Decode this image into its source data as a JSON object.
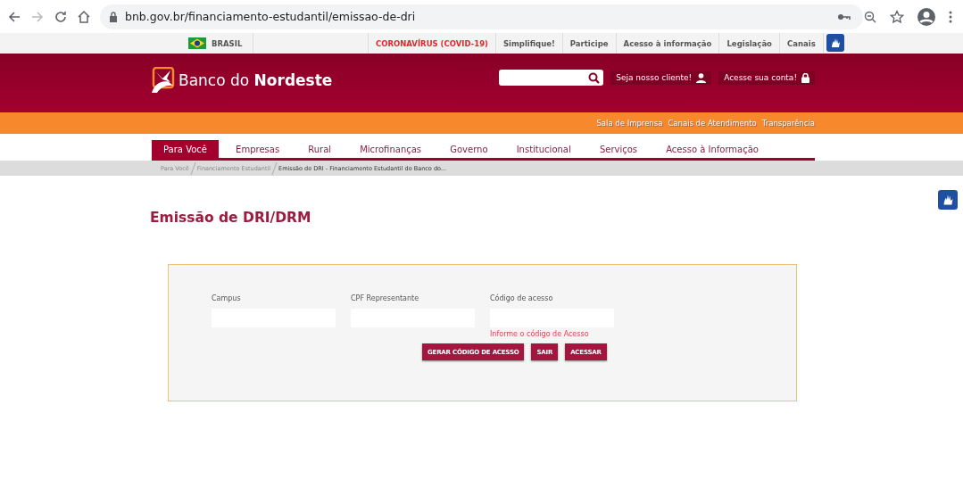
{
  "browser": {
    "url": "bnb.gov.br/financiamento-estudantil/emissao-de-dri"
  },
  "top_links": [
    {
      "label": "BRASIL",
      "kind": "country"
    },
    {
      "label": "CORONAVÍRUS (COVID-19)",
      "kind": "alert"
    },
    {
      "label": "Simplifique!",
      "kind": "link"
    },
    {
      "label": "Participe",
      "kind": "link"
    },
    {
      "label": "Acesso à informação",
      "kind": "link"
    },
    {
      "label": "Legislação",
      "kind": "link"
    },
    {
      "label": "Canais",
      "kind": "link"
    }
  ],
  "header": {
    "logo": "Banco do **Nordeste**",
    "actions": [
      {
        "label": "Seja nosso cliente!",
        "kind": "user"
      },
      {
        "label": "Acesse sua conta!",
        "kind": "lock"
      }
    ]
  },
  "orange_links": [
    "Sala de Imprensa",
    "Canais de Atendimento",
    "Transparência"
  ],
  "nav": [
    {
      "label": "Para Você",
      "selected": true
    },
    {
      "label": "Empresas",
      "selected": false
    },
    {
      "label": "Rural",
      "selected": false
    },
    {
      "label": "Microfinanças",
      "selected": false
    },
    {
      "label": "Governo",
      "selected": false
    },
    {
      "label": "Institucional",
      "selected": false
    },
    {
      "label": "Serviços",
      "selected": false
    },
    {
      "label": "Acesso à Informação",
      "selected": false
    }
  ],
  "breadcrumb": [
    {
      "label": "Para Você",
      "selected": false
    },
    {
      "label": "Financiamento Estudantil",
      "selected": false
    },
    {
      "label": "Emissão de DRI - Financiamento Estudantil do Banco do...",
      "selected": true
    }
  ],
  "page_title": "Emissão de DRI/DRM",
  "form": {
    "fields": [
      {
        "label": "Campus"
      },
      {
        "label": "CPF Representante"
      },
      {
        "label": "Código de acesso",
        "error": "Informe o código de Acesso"
      }
    ],
    "buttons": [
      "GERAR CÓDIGO DE ACESSO",
      "SAIR",
      "ACESSAR"
    ]
  }
}
